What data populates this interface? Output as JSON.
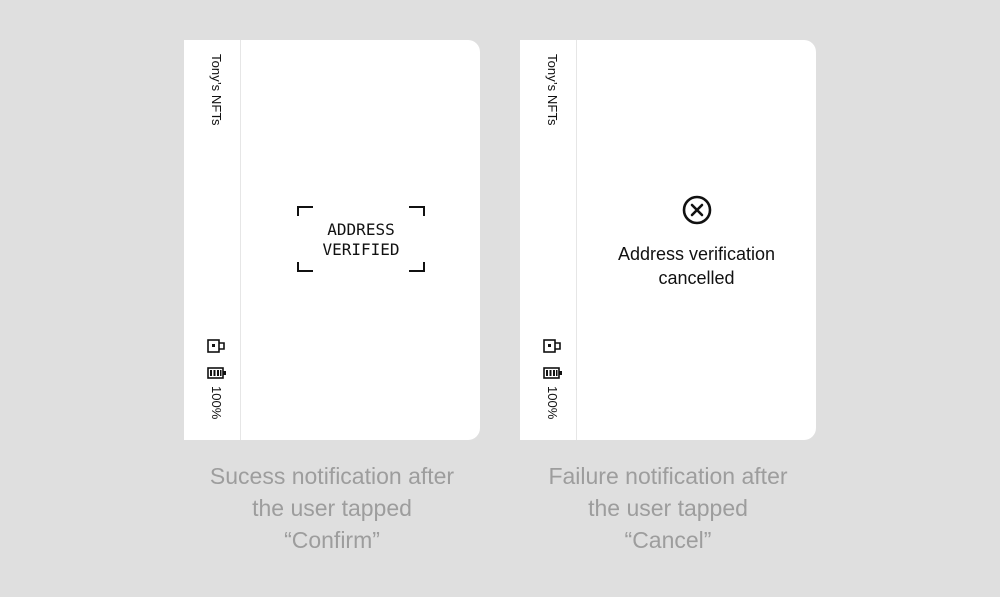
{
  "success_panel": {
    "app_name": "Tony’s NFTs",
    "battery_percent": "100%",
    "message_line1": "ADDRESS",
    "message_line2": "VERIFIED",
    "caption_line1": "Sucess notification after",
    "caption_line2": "the user tapped",
    "caption_line3": "“Confirm”"
  },
  "failure_panel": {
    "app_name": "Tony’s NFTs",
    "battery_percent": "100%",
    "icon": "cancel-circle-icon",
    "message_line1": "Address verification",
    "message_line2": "cancelled",
    "caption_line1": "Failure notification after",
    "caption_line2": "the user tapped",
    "caption_line3": "“Cancel”"
  },
  "colors": {
    "background": "#dfdfdf",
    "device": "#ffffff",
    "text": "#111111",
    "caption": "#9d9d9d"
  }
}
